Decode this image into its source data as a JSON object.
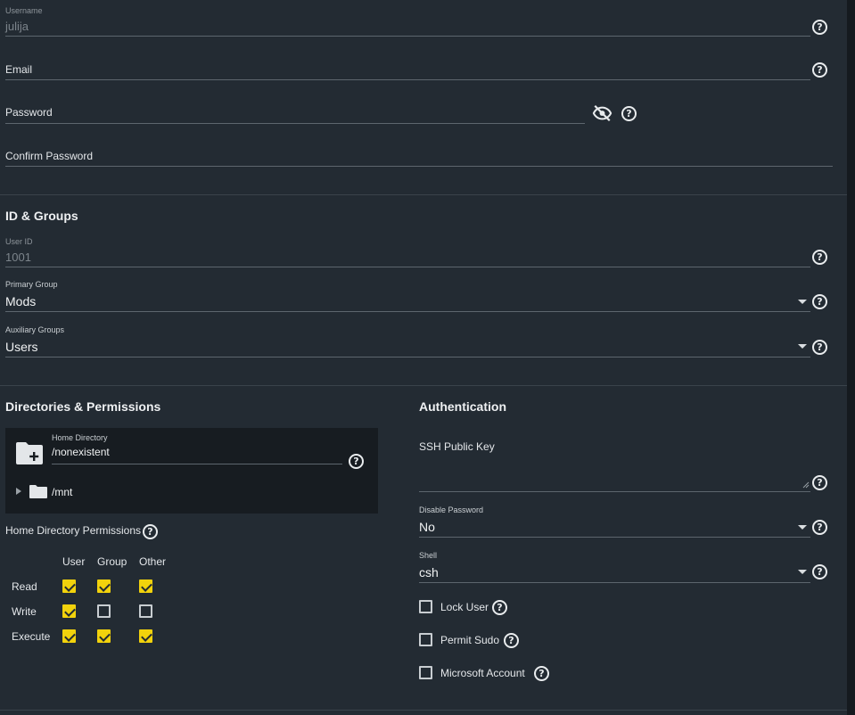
{
  "account": {
    "username": {
      "label": "Username",
      "value": "julija"
    },
    "email": {
      "label": "Email"
    },
    "password": {
      "label": "Password"
    },
    "confirm_password": {
      "label": "Confirm Password"
    }
  },
  "id_groups": {
    "title": "ID & Groups",
    "user_id": {
      "label": "User ID",
      "value": "1001"
    },
    "primary_group": {
      "label": "Primary Group",
      "value": "Mods"
    },
    "auxiliary_groups": {
      "label": "Auxiliary Groups",
      "value": "Users"
    }
  },
  "directories": {
    "title": "Directories & Permissions",
    "home_directory": {
      "label": "Home Directory",
      "value": "/nonexistent"
    },
    "tree_item": "/mnt",
    "permissions_label": "Home Directory Permissions",
    "columns": [
      "User",
      "Group",
      "Other"
    ],
    "rows": [
      {
        "label": "Read",
        "checks": [
          true,
          true,
          true
        ]
      },
      {
        "label": "Write",
        "checks": [
          true,
          false,
          false
        ]
      },
      {
        "label": "Execute",
        "checks": [
          true,
          true,
          true
        ]
      }
    ]
  },
  "authentication": {
    "title": "Authentication",
    "ssh_key": {
      "label": "SSH Public Key"
    },
    "disable_password": {
      "label": "Disable Password",
      "value": "No"
    },
    "shell": {
      "label": "Shell",
      "value": "csh"
    },
    "lock_user": {
      "label": "Lock User",
      "checked": false
    },
    "permit_sudo": {
      "label": "Permit Sudo",
      "checked": false
    },
    "microsoft_account": {
      "label": "Microsoft Account",
      "checked": false
    }
  },
  "icons": {
    "help": "?",
    "visibility_off": "eye-off-icon",
    "folder_add": "folder-plus-icon",
    "folder": "folder-icon"
  },
  "colors": {
    "background": "#232b33",
    "accent": "#f2d20c"
  }
}
